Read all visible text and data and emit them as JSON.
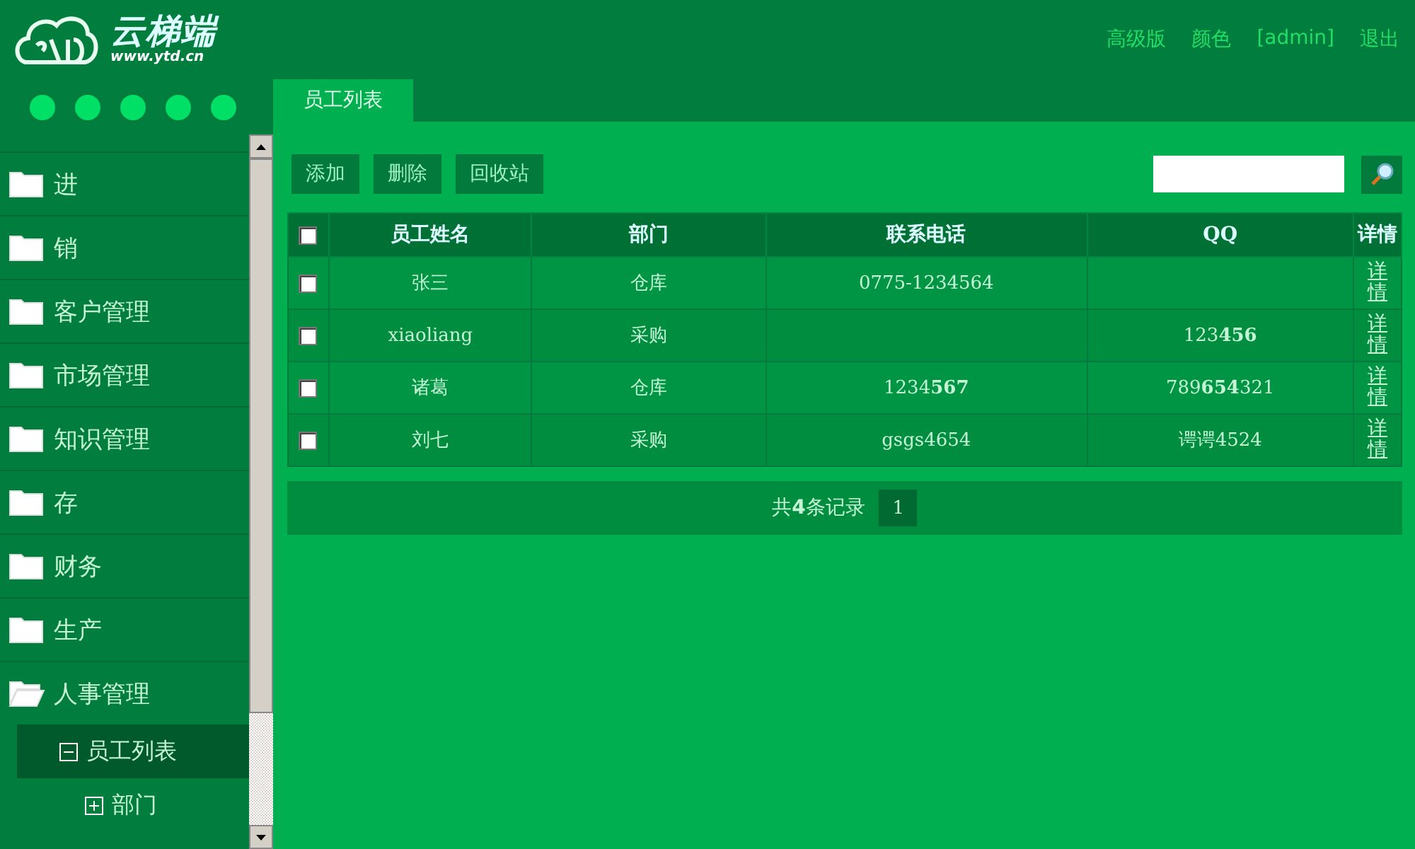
{
  "logo": {
    "name": "云梯端",
    "url": "www.ytd.cn"
  },
  "header_links": [
    "高级版",
    "颜色",
    "[admin]",
    "退出"
  ],
  "sidebar": {
    "items": [
      {
        "label": "进",
        "expanded": false
      },
      {
        "label": "销",
        "expanded": false
      },
      {
        "label": "客户管理",
        "expanded": false
      },
      {
        "label": "市场管理",
        "expanded": false
      },
      {
        "label": "知识管理",
        "expanded": false
      },
      {
        "label": "存",
        "expanded": false
      },
      {
        "label": "财务",
        "expanded": false
      },
      {
        "label": "生产",
        "expanded": false
      },
      {
        "label": "人事管理",
        "expanded": true,
        "children": [
          {
            "label": "员工列表",
            "selected": true,
            "expanded": true
          },
          {
            "label": "部门",
            "selected": false,
            "expanded": false
          }
        ]
      }
    ]
  },
  "tabs": [
    {
      "label": "员工列表",
      "selected": true
    }
  ],
  "toolbar": {
    "buttons": [
      "添加",
      "删除",
      "回收站"
    ]
  },
  "table": {
    "all_checked": false,
    "columns": [
      "员工姓名",
      "部门",
      "联系电话",
      "QQ",
      "详情"
    ],
    "rows": [
      {
        "checked": false,
        "cells": [
          "张三",
          "仓库",
          "0775-1234564",
          ""
        ],
        "detail": "详情"
      },
      {
        "checked": false,
        "cells": [
          "xiaoliang",
          "采购",
          "",
          "123**456**"
        ],
        "detail": "详情"
      },
      {
        "checked": false,
        "cells": [
          "诸葛",
          "仓库",
          "1234**567**",
          "789**654**321"
        ],
        "detail": "详情"
      },
      {
        "checked": false,
        "cells": [
          "刘七",
          "采购",
          "gsgs4654",
          "谔谔4524"
        ],
        "detail": "详情"
      }
    ]
  },
  "pager": {
    "summary": "共**4**条记录",
    "pages": [
      {
        "label": "1",
        "selected": true
      }
    ]
  }
}
